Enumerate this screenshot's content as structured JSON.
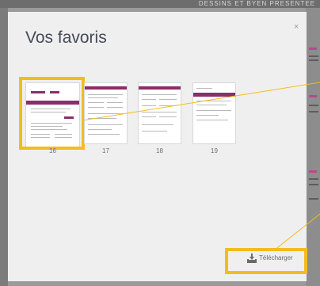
{
  "background": {
    "header_text": "DESSINS ET BYEN PRESENTEE"
  },
  "modal": {
    "title": "Vos favoris",
    "close_glyph": "×",
    "download_label": "Télécharger"
  },
  "favorites": [
    {
      "page": "16",
      "selected": true
    },
    {
      "page": "17",
      "selected": false
    },
    {
      "page": "18",
      "selected": false
    },
    {
      "page": "19",
      "selected": false
    }
  ],
  "colors": {
    "highlight": "#f2bd1c",
    "accent": "#8b2e6a",
    "title_text": "#444a58"
  },
  "icons": {
    "download": "download-tray-icon",
    "close": "close-icon"
  }
}
